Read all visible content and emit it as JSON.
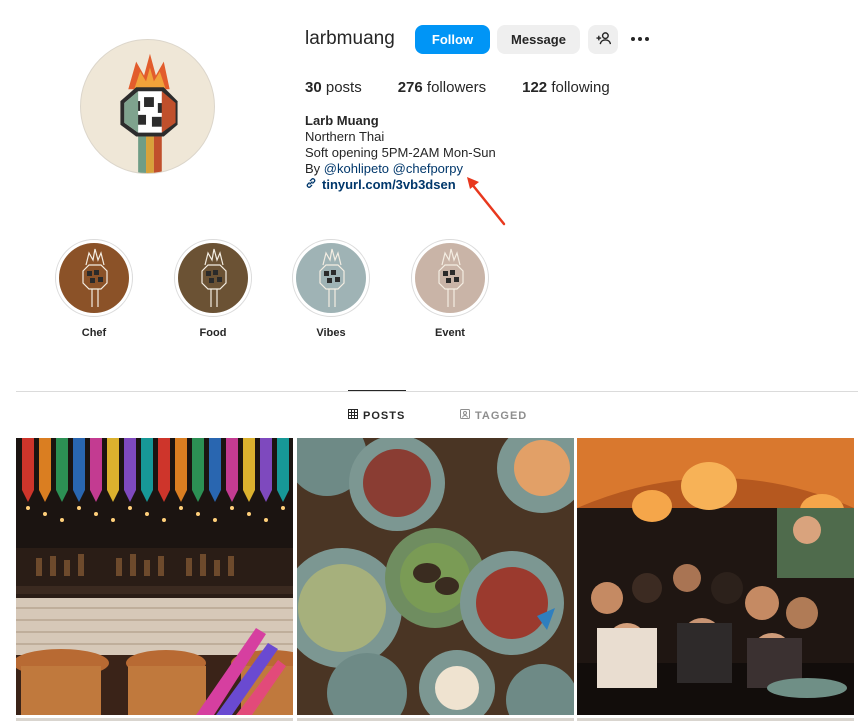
{
  "profile": {
    "username": "larbmuang",
    "follow_label": "Follow",
    "message_label": "Message",
    "stats": {
      "posts_count": "30",
      "posts_label": "posts",
      "followers_count": "276",
      "followers_label": "followers",
      "following_count": "122",
      "following_label": "following"
    },
    "bio": {
      "name": "Larb Muang",
      "line1": "Northern Thai",
      "line2": "Soft opening 5PM-2AM Mon-Sun",
      "by_prefix": "By",
      "mention1": "@kohlipeto",
      "mention2": "@chefporpy",
      "link": "tinyurl.com/3vb3dsen"
    }
  },
  "highlights": [
    {
      "label": "Chef",
      "color": "#8b5228"
    },
    {
      "label": "Food",
      "color": "#6b5234"
    },
    {
      "label": "Vibes",
      "color": "#9fb3b5"
    },
    {
      "label": "Event",
      "color": "#c9b4a7"
    }
  ],
  "tabs": {
    "posts_label": "POSTS",
    "tagged_label": "TAGGED"
  },
  "colors": {
    "accent": "#0095f6",
    "link": "#00376b",
    "annotation_arrow": "#e8381e"
  },
  "icons": {
    "add_user": "person-plus-icon",
    "more": "ellipsis-icon",
    "link": "chain-link-icon",
    "grid": "grid-icon",
    "tagged": "tag-person-icon"
  }
}
